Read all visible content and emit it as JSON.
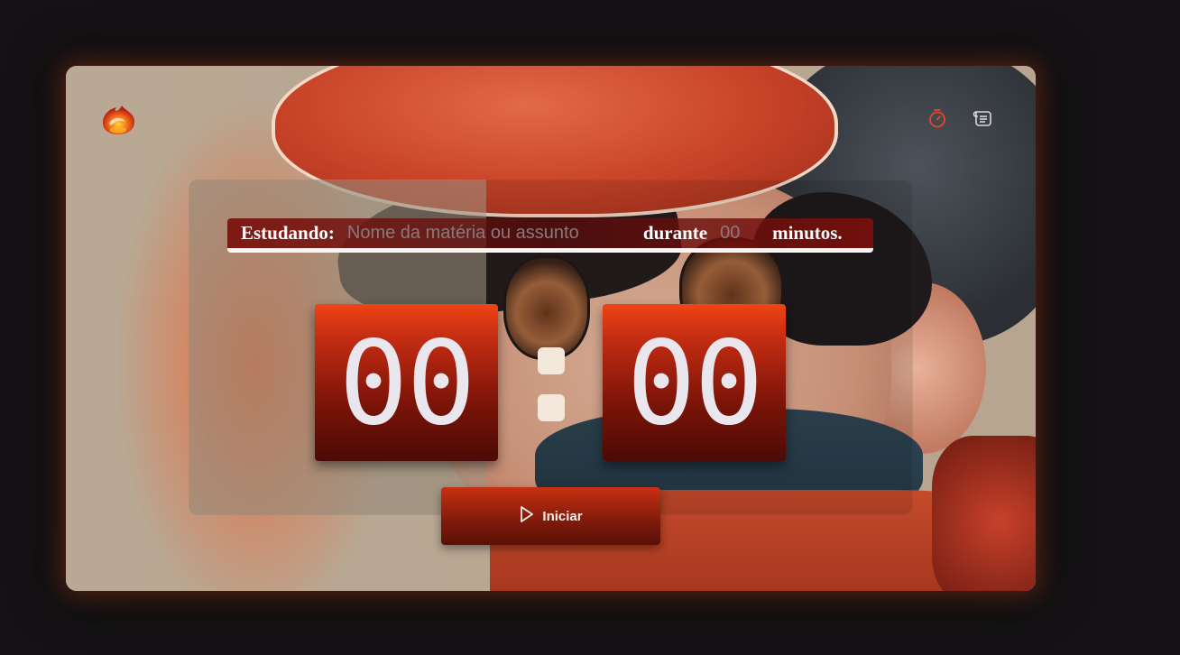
{
  "header": {
    "logo_icon": "fire-logo-icon",
    "nav": [
      {
        "icon": "stopwatch-icon",
        "active": true,
        "color": "#e3462a"
      },
      {
        "icon": "scroll-history-icon",
        "active": false,
        "color": "#dcd6d6"
      }
    ]
  },
  "task": {
    "studying_label": "Estudando:",
    "subject_placeholder": "Nome da matéria ou assunto",
    "subject_value": "",
    "during_label": "durante",
    "minutes_placeholder": "00",
    "minutes_value": "",
    "minutes_label": "minutos."
  },
  "countdown": {
    "minutes": "00",
    "separator": ":",
    "seconds": "00"
  },
  "start_button": {
    "icon": "play-icon",
    "label": "Iniciar"
  },
  "colors": {
    "accent": "#e3462a",
    "digit_top": "#f04414",
    "digit_bottom": "#4a0b06",
    "digit_text": "#e9e6ee"
  }
}
